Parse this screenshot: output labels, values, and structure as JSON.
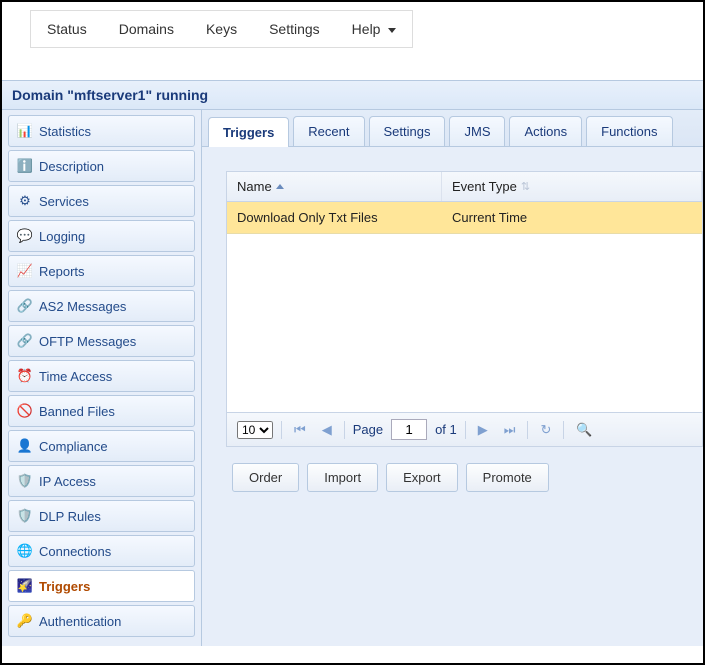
{
  "topmenu": {
    "status": "Status",
    "domains": "Domains",
    "keys": "Keys",
    "settings": "Settings",
    "help": "Help"
  },
  "domain_header": "Domain \"mftserver1\" running",
  "sidebar": {
    "items": [
      {
        "label": "Statistics"
      },
      {
        "label": "Description"
      },
      {
        "label": "Services"
      },
      {
        "label": "Logging"
      },
      {
        "label": "Reports"
      },
      {
        "label": "AS2 Messages"
      },
      {
        "label": "OFTP Messages"
      },
      {
        "label": "Time Access"
      },
      {
        "label": "Banned Files"
      },
      {
        "label": "Compliance"
      },
      {
        "label": "IP Access"
      },
      {
        "label": "DLP Rules"
      },
      {
        "label": "Connections"
      },
      {
        "label": "Triggers"
      },
      {
        "label": "Authentication"
      }
    ]
  },
  "tabs": {
    "triggers": "Triggers",
    "recent": "Recent",
    "settings": "Settings",
    "jms": "JMS",
    "actions": "Actions",
    "functions": "Functions"
  },
  "grid": {
    "columns": {
      "name": "Name",
      "type": "Event Type"
    },
    "rows": [
      {
        "name": "Download Only Txt Files",
        "type": "Current Time"
      }
    ]
  },
  "pager": {
    "pagesize": "10",
    "page_label": "Page",
    "page_value": "1",
    "of_label": "of 1"
  },
  "buttons": {
    "order": "Order",
    "import": "Import",
    "export": "Export",
    "promote": "Promote"
  }
}
